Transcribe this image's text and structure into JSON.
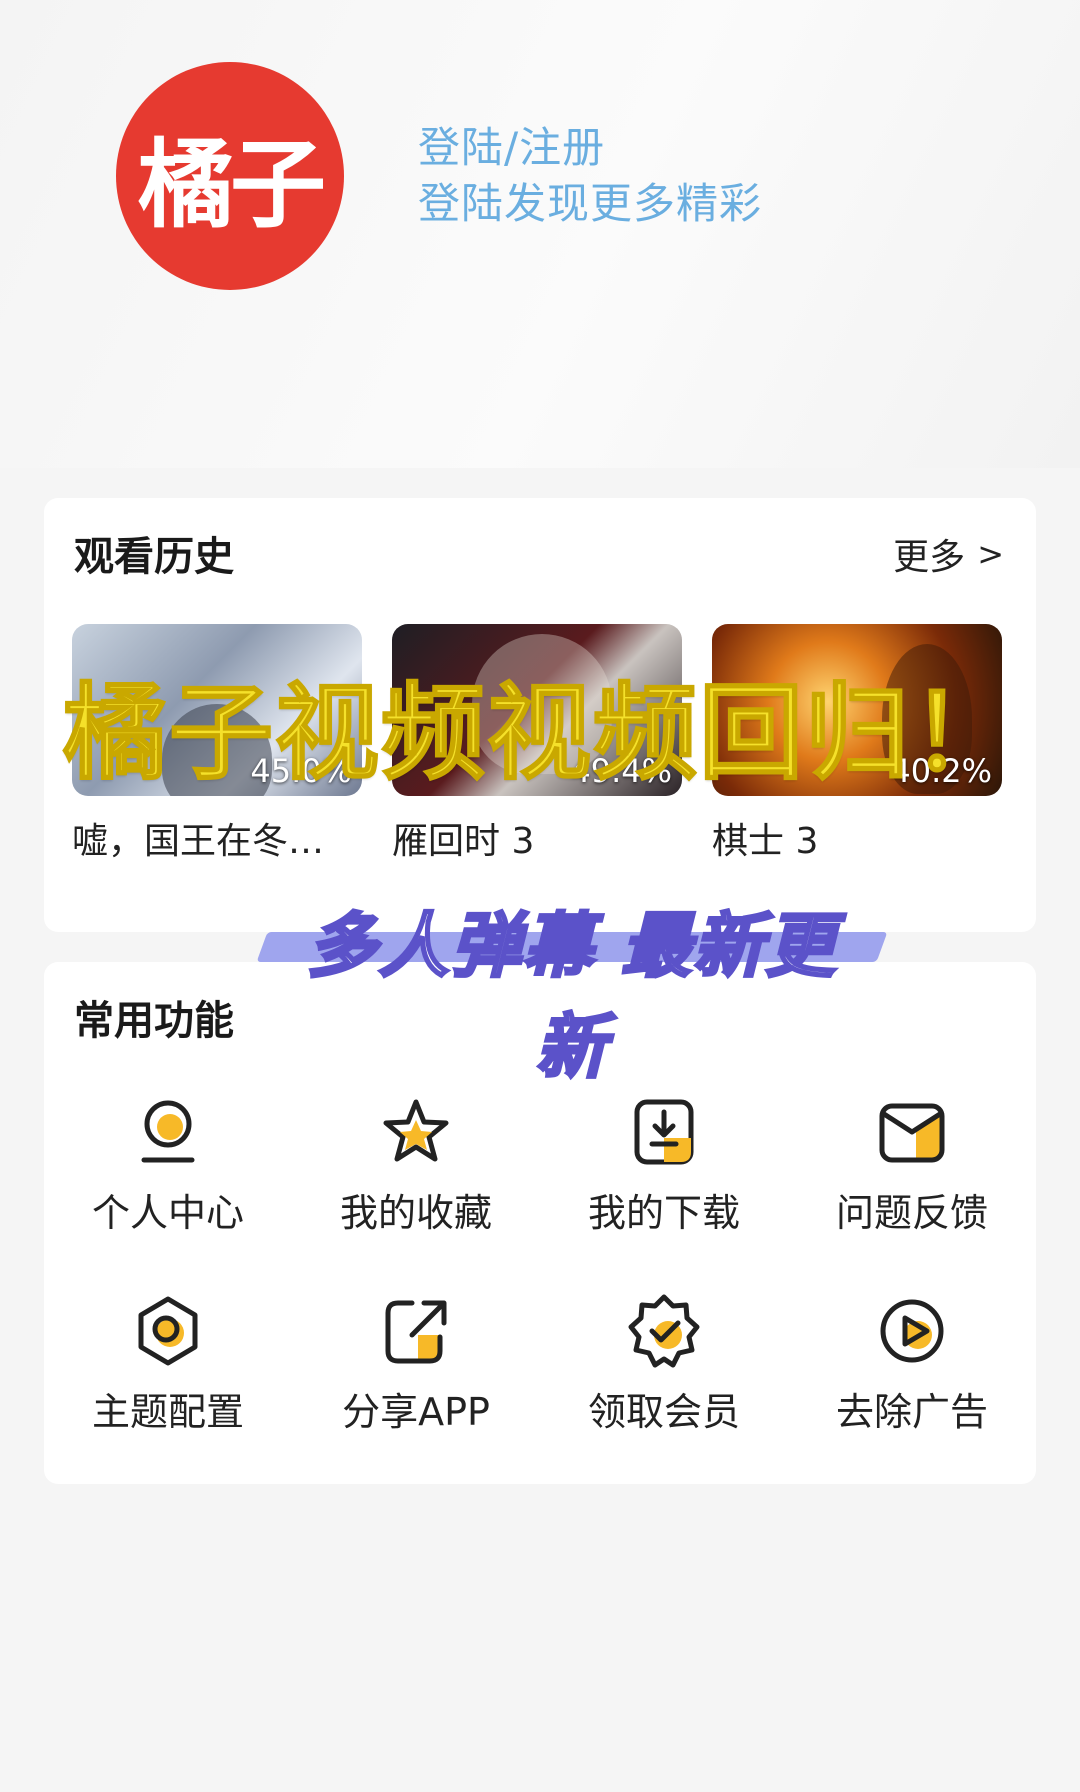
{
  "header": {
    "logo_text": "橘子",
    "login_title": "登陆/注册",
    "login_subtitle": "登陆发现更多精彩"
  },
  "history": {
    "title": "观看历史",
    "more_label": "更多",
    "more_arrow": ">",
    "items": [
      {
        "caption": "嘘，国王在冬…",
        "progress": "45.0%"
      },
      {
        "caption": "雁回时 3",
        "progress": "49.4%"
      },
      {
        "caption": "棋士 3",
        "progress": "40.2%"
      }
    ]
  },
  "overlay": {
    "main_text": "橘子视频视频回归！",
    "sub_text": "多人弹幕 最新更新"
  },
  "functions": {
    "title": "常用功能",
    "items": [
      {
        "label": "个人中心",
        "icon": "user-icon"
      },
      {
        "label": "我的收藏",
        "icon": "star-icon"
      },
      {
        "label": "我的下载",
        "icon": "download-icon"
      },
      {
        "label": "问题反馈",
        "icon": "mail-icon"
      },
      {
        "label": "主题配置",
        "icon": "theme-icon"
      },
      {
        "label": "分享APP",
        "icon": "share-icon"
      },
      {
        "label": "领取会员",
        "icon": "badge-check-icon"
      },
      {
        "label": "去除广告",
        "icon": "play-icon"
      }
    ]
  },
  "colors": {
    "logo_red": "#e63a30",
    "login_blue": "#6aaee0",
    "icon_yellow": "#f7b928",
    "overlay_yellow": "#f5e12a",
    "overlay_purple": "#5b52c9"
  }
}
